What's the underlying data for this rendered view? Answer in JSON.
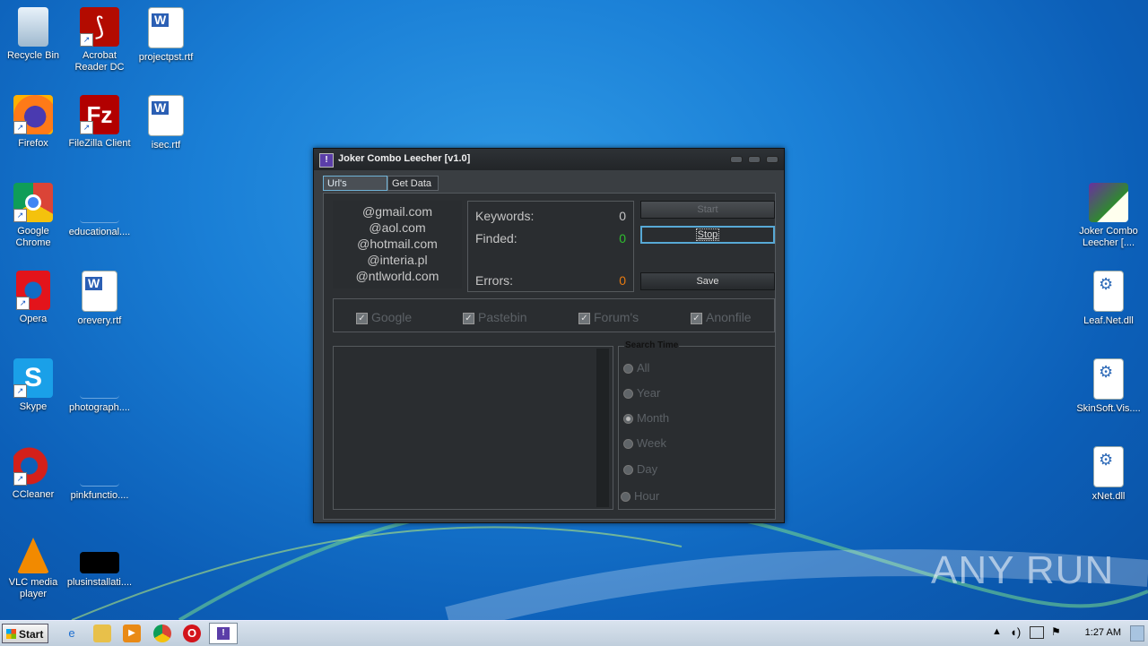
{
  "desktop_icons_left": [
    {
      "label": "Recycle Bin",
      "icon": "recycle-bin-icon"
    },
    {
      "label": "Acrobat Reader DC",
      "icon": "acrobat-icon"
    },
    {
      "label": "projectpst.rtf",
      "icon": "word-doc-icon"
    },
    {
      "label": "Firefox",
      "icon": "firefox-icon"
    },
    {
      "label": "FileZilla Client",
      "icon": "filezilla-icon"
    },
    {
      "label": "isec.rtf",
      "icon": "word-doc-icon"
    },
    {
      "label": "Google Chrome",
      "icon": "chrome-icon"
    },
    {
      "label": "educational....",
      "icon": "blank-file-icon"
    },
    {
      "label": "Opera",
      "icon": "opera-icon"
    },
    {
      "label": "orevery.rtf",
      "icon": "word-doc-icon"
    },
    {
      "label": "Skype",
      "icon": "skype-icon"
    },
    {
      "label": "photograph....",
      "icon": "blank-file-icon"
    },
    {
      "label": "CCleaner",
      "icon": "ccleaner-icon"
    },
    {
      "label": "pinkfunctio....",
      "icon": "blank-file-icon"
    },
    {
      "label": "VLC media player",
      "icon": "vlc-icon"
    },
    {
      "label": "plusinstallati....",
      "icon": "black-file-icon"
    }
  ],
  "desktop_icons_right": [
    {
      "label": "Joker Combo Leecher [....",
      "icon": "joker-icon"
    },
    {
      "label": "Leaf.Net.dll",
      "icon": "dll-icon"
    },
    {
      "label": "SkinSoft.Vis....",
      "icon": "dll-icon"
    },
    {
      "label": "xNet.dll",
      "icon": "dll-icon"
    }
  ],
  "window": {
    "title": "Joker Combo Leecher [v1.0]",
    "tabs": [
      "Url's Grabber",
      "Get Data"
    ],
    "domains": [
      "@gmail.com",
      "@aol.com",
      "@hotmail.com",
      "@interia.pl",
      "@ntlworld.com"
    ],
    "stats": {
      "keywords_label": "Keywords:",
      "keywords_value": "0",
      "finded_label": "Finded:",
      "finded_value": "0",
      "errors_label": "Errors:",
      "errors_value": "0"
    },
    "buttons": {
      "start": "Start",
      "stop": "Stop",
      "save": "Save"
    },
    "sources": [
      "Google",
      "Pastebin",
      "Forum's",
      "Anonfile"
    ],
    "search_time": {
      "title": "Search Time",
      "options": [
        "All",
        "Year",
        "Month",
        "Week",
        "Day",
        "Hour"
      ],
      "selected": "Month"
    }
  },
  "taskbar": {
    "start_label": "Start",
    "clock": "1:27 AM"
  },
  "watermark": "ANY RUN",
  "colors": {
    "finded_value": "#2fbf2f",
    "errors_value": "#e87a10",
    "focus_border": "#57a9d6"
  }
}
